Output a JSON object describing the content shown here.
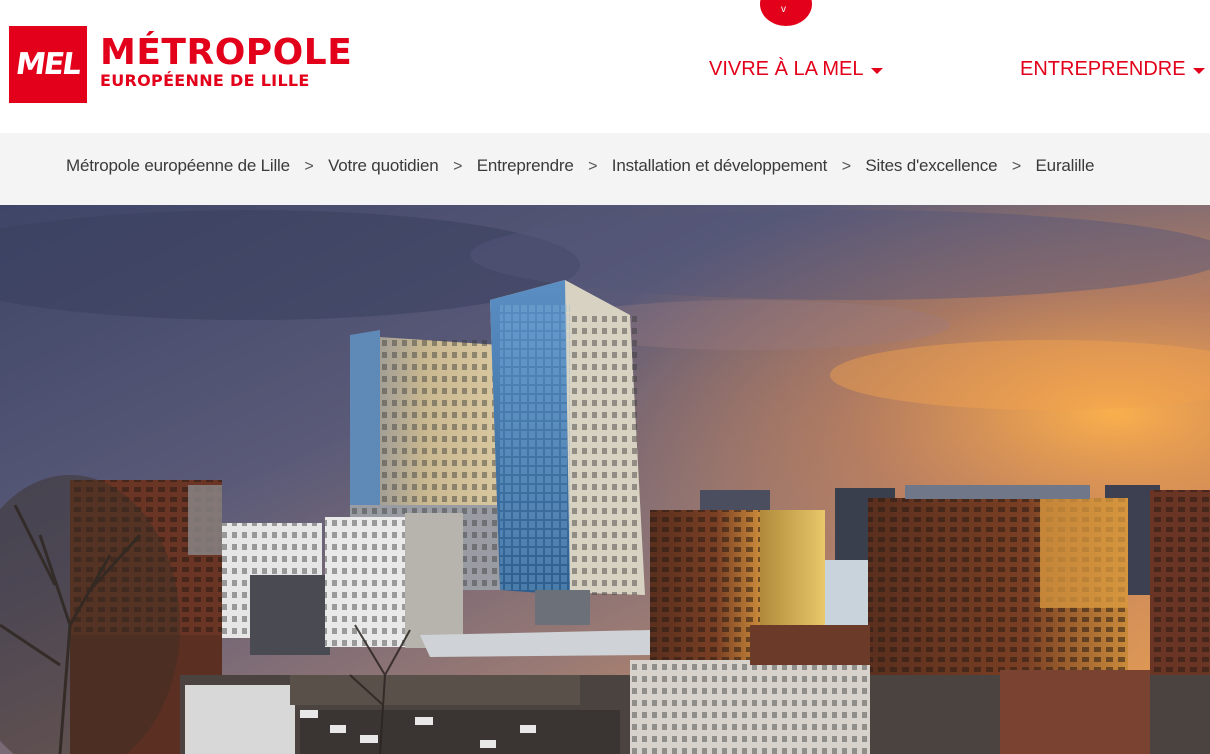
{
  "header": {
    "logo_mark": "MEL",
    "logo_line1": "MÉTROPOLE",
    "logo_line2": "EUROPÉENNE DE LILLE",
    "badge_glyph": "v",
    "nav": [
      {
        "label": "VIVRE À LA MEL"
      },
      {
        "label": "ENTREPRENDRE"
      }
    ]
  },
  "breadcrumb": [
    "Métropole européenne de Lille",
    "Votre quotidien",
    "Entreprendre",
    "Installation et développement",
    "Sites d'excellence",
    "Euralille"
  ],
  "breadcrumb_separator": ">",
  "hero": {
    "image_subject": "euralille-city-skyline-sunset"
  },
  "colors": {
    "brand_red": "#e2001a",
    "breadcrumb_bg": "#f4f4f4",
    "text_dark": "#3a3a3a"
  }
}
